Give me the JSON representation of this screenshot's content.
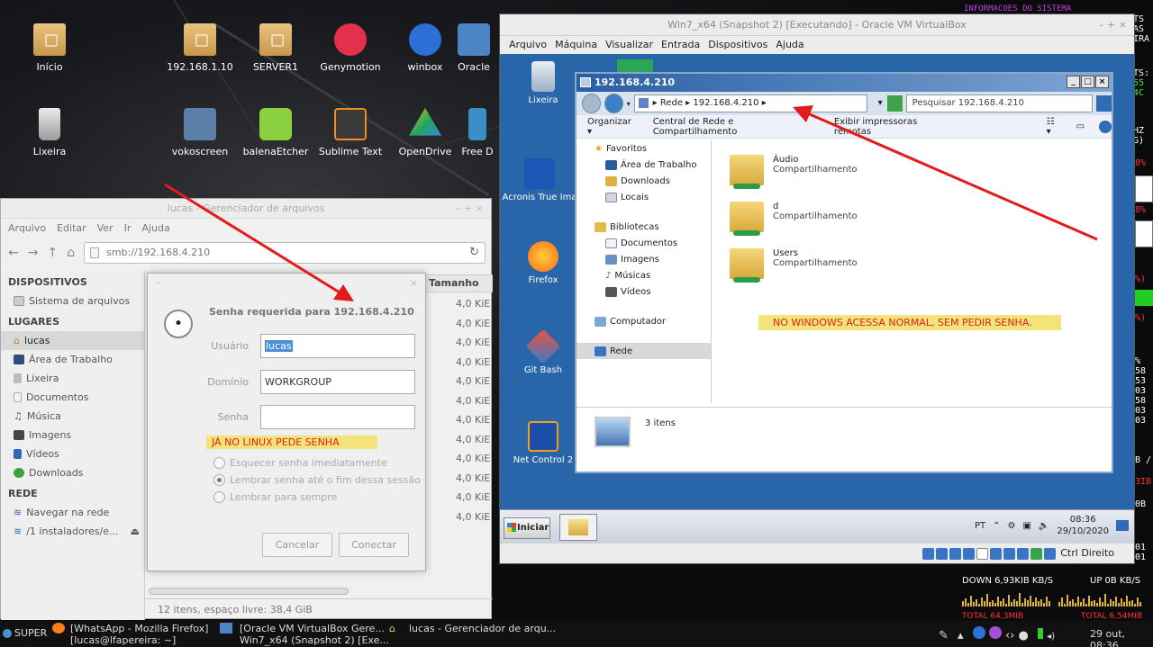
{
  "desktop": {
    "icons": [
      {
        "label": "Início",
        "icon": "home-folder-icon"
      },
      {
        "label": "192.168.1.10",
        "icon": "network-folder-icon"
      },
      {
        "label": "SERVER1",
        "icon": "network-folder-icon"
      },
      {
        "label": "Genymotion",
        "icon": "genymotion-icon"
      },
      {
        "label": "winbox",
        "icon": "winbox-icon"
      },
      {
        "label": "Oracle",
        "icon": "virtualbox-icon"
      },
      {
        "label": "Lixeira",
        "icon": "trash-icon"
      },
      {
        "label": "vokoscreen",
        "icon": "vokoscreen-icon"
      },
      {
        "label": "balenaEtcher",
        "icon": "etcher-icon"
      },
      {
        "label": "Sublime Text",
        "icon": "sublime-icon"
      },
      {
        "label": "OpenDrive",
        "icon": "opendrive-icon"
      },
      {
        "label": "Free D",
        "icon": "app-icon"
      }
    ]
  },
  "conky": {
    "header": "INFORMACOES DO SISTEMA",
    "edge_labels": [
      "TS",
      "AS",
      "IRA",
      "TS:",
      "55",
      "4C",
      "HZ",
      "G)",
      "8%",
      "8%",
      "%)",
      "%)",
      "%",
      "58",
      "53",
      "03",
      "58",
      "03",
      "03",
      "B /",
      "3IB",
      "0B",
      "01",
      "01"
    ],
    "down_label": "DOWN 6,93KIB KB/S",
    "up_label": "UP 0B  KB/S",
    "total_left": "TOTAL 64,3MIB",
    "total_right": "TOTAL 6,54MIB"
  },
  "thunar": {
    "title": "lucas - Gerenciador de arquivos",
    "menu": [
      "Arquivo",
      "Editar",
      "Ver",
      "Ir",
      "Ajuda"
    ],
    "location": "smb://192.168.4.210",
    "column_size": "Tamanho",
    "sizes": [
      "4,0 KiE",
      "4,0 KiE",
      "4,0 KiE",
      "4,0 KiE",
      "4,0 KiE",
      "4,0 KiE",
      "4,0 KiE",
      "4,0 KiE",
      "4,0 KiE",
      "4,0 KiE",
      "4,0 KiE",
      "4,0 KiE"
    ],
    "sidebar": {
      "devices_header": "DISPOSITIVOS",
      "devices": [
        "Sistema de arquivos"
      ],
      "places_header": "LUGARES",
      "places": [
        "lucas",
        "Área de Trabalho",
        "Lixeira",
        "Documentos",
        "Música",
        "Imagens",
        "Vídeos",
        "Downloads"
      ],
      "network_header": "REDE",
      "network": [
        "Navegar na rede",
        "/1 instaladores/e..."
      ]
    },
    "status": "12 itens, espaço livre: 38,4 GiB"
  },
  "dialog": {
    "title": "Senha requerida para 192.168.4.210",
    "user_label": "Usuário",
    "user_value": "lucas",
    "domain_label": "Domínio",
    "domain_value": "WORKGROUP",
    "password_label": "Senha",
    "password_value": "",
    "note": "JÁ NO LINUX PEDE SENHA",
    "options": [
      "Esquecer senha imediatamente",
      "Lembrar senha até o fim dessa sessão",
      "Lembrar para sempre"
    ],
    "selected_option": 1,
    "cancel": "Cancelar",
    "connect": "Conectar"
  },
  "vbox": {
    "title": "Win7_x64 (Snapshot 2) [Executando] - Oracle VM VirtualBox",
    "menu": [
      "Arquivo",
      "Máquina",
      "Visualizar",
      "Entrada",
      "Dispositivos",
      "Ajuda"
    ],
    "host_key": "Ctrl Direito"
  },
  "win7": {
    "desktop_icons": [
      "Lixeira",
      "Acronis True Ima",
      "Firefox",
      "Git Bash",
      "Net Control 2"
    ],
    "explorer": {
      "title": "192.168.4.210",
      "breadcrumb": "▸ Rede ▸ 192.168.4.210 ▸",
      "search_placeholder": "Pesquisar 192.168.4.210",
      "commands": [
        "Organizar ▾",
        "Central de Rede e Compartilhamento",
        "Exibir impressoras remotas"
      ],
      "nav_favorites": "Favoritos",
      "favorites": [
        "Área de Trabalho",
        "Downloads",
        "Locais"
      ],
      "nav_libraries": "Bibliotecas",
      "libraries": [
        "Documentos",
        "Imagens",
        "Músicas",
        "Vídeos"
      ],
      "nav_computer": "Computador",
      "nav_network": "Rede",
      "items": [
        {
          "name": "Áudio",
          "type": "Compartilhamento"
        },
        {
          "name": "d",
          "type": "Compartilhamento"
        },
        {
          "name": "Users",
          "type": "Compartilhamento"
        }
      ],
      "note": "NO WINDOWS ACESSA NORMAL, SEM PEDIR SENHA.",
      "count": "3 itens"
    },
    "taskbar": {
      "start": "Iniciar",
      "lang": "PT",
      "time": "08:36",
      "date": "29/10/2020"
    }
  },
  "linux_taskbar": {
    "menu": "SUPER",
    "tasks": [
      {
        "line1": "[WhatsApp - Mozilla Firefox]",
        "line2": "[lucas@lfapereira: ~]"
      },
      {
        "line1": "[Oracle VM VirtualBox Gere...",
        "line2": "Win7_x64 (Snapshot 2) [Exe..."
      },
      {
        "line1": "lucas - Gerenciador de arqu...",
        "line2": ""
      }
    ],
    "clock": "29 out, 08:36"
  },
  "colors": {
    "annotation_arrow": "#e21b1b",
    "note_bg": "#f3e47a",
    "win_blue": "#2866a9"
  }
}
